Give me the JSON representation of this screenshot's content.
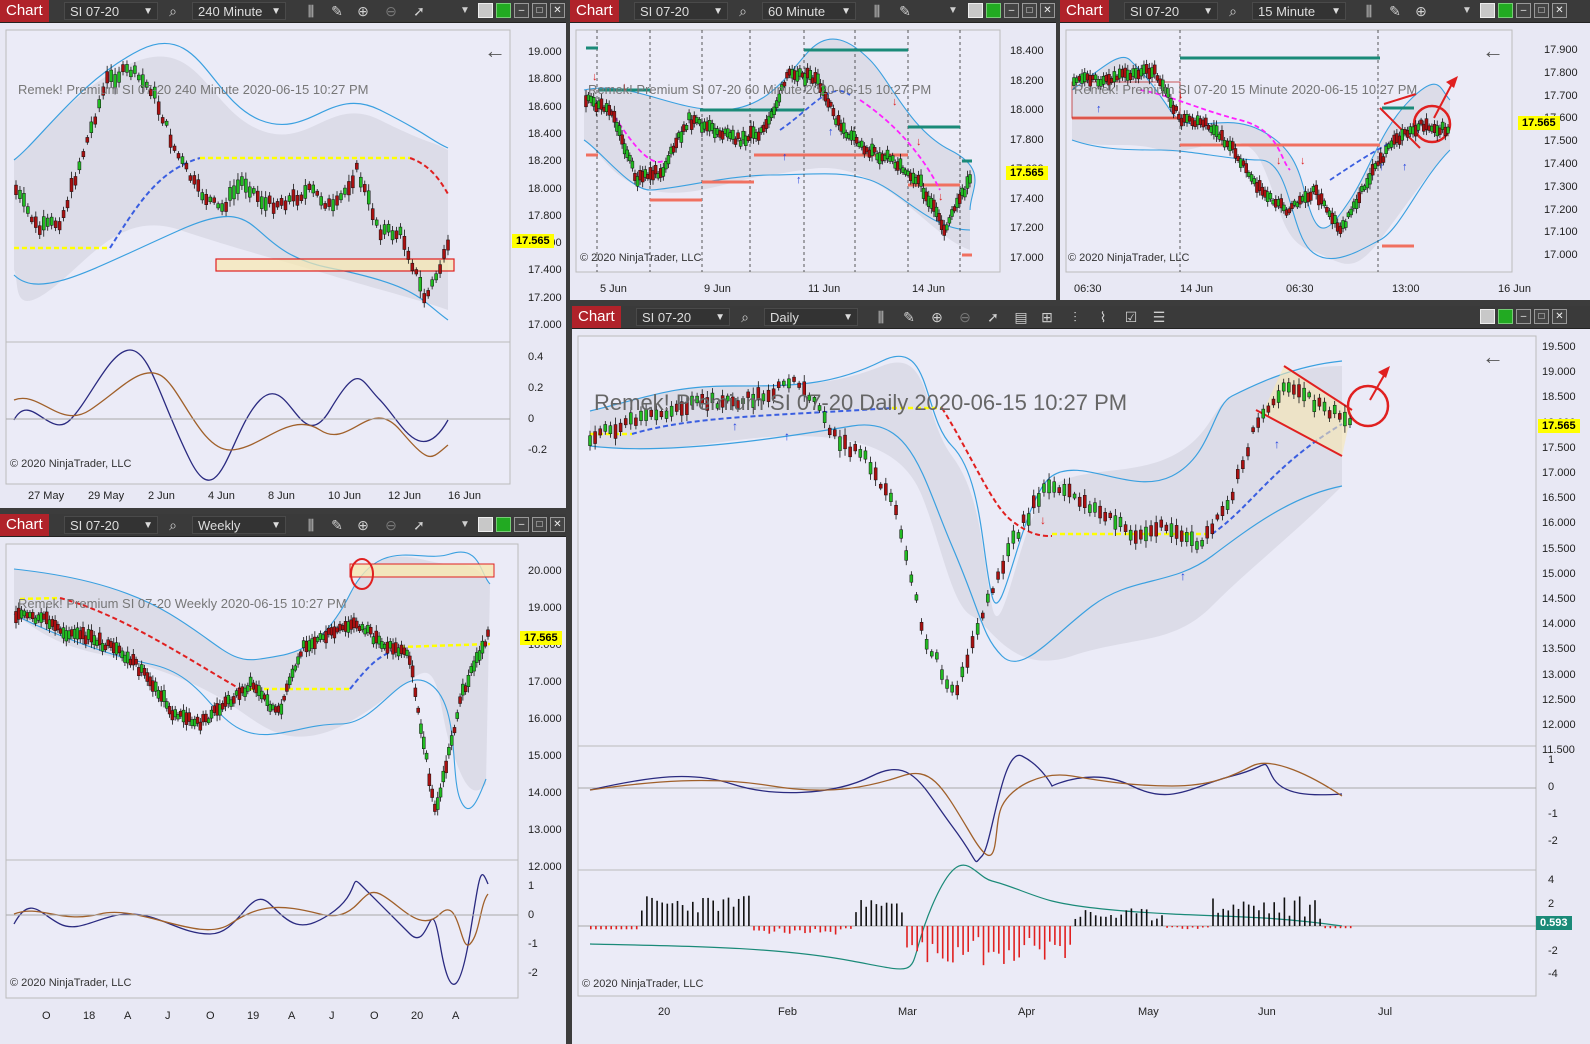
{
  "common": {
    "tab_label": "Chart",
    "instrument": "SI 07-20",
    "copyright": "© 2020 NinjaTrader, LLC",
    "last_price": "17.565"
  },
  "charts": {
    "m240": {
      "interval": "240 Minute",
      "title": "Remek!  Premium  SI 07-20  240 Minute  2020-06-15 10:27 PM",
      "price_ticks": [
        "19.000",
        "18.800",
        "18.600",
        "18.400",
        "18.200",
        "18.000",
        "17.800",
        "17.600",
        "17.400",
        "17.200",
        "17.000"
      ],
      "osc_ticks": [
        "0.4",
        "0.2",
        "0",
        "-0.2"
      ],
      "time_ticks": [
        "27 May",
        "29 May",
        "2 Jun",
        "4 Jun",
        "8 Jun",
        "10 Jun",
        "12 Jun",
        "16 Jun"
      ]
    },
    "m60": {
      "interval": "60 Minute",
      "title": "Remek!  Premium  SI 07-20  60 Minute  2020-06-15 10:27 PM",
      "price_ticks": [
        "18.400",
        "18.200",
        "18.000",
        "17.800",
        "17.600",
        "17.400",
        "17.200",
        "17.000"
      ],
      "time_ticks": [
        "5 Jun",
        "9 Jun",
        "11 Jun",
        "14 Jun"
      ]
    },
    "m15": {
      "interval": "15 Minute",
      "title": "Remek!  Premium  SI 07-20  15 Minute  2020-06-15 10:27 PM",
      "price_ticks": [
        "17.900",
        "17.800",
        "17.700",
        "17.600",
        "17.500",
        "17.400",
        "17.300",
        "17.200",
        "17.100",
        "17.000"
      ],
      "time_ticks": [
        "06:30",
        "14 Jun",
        "06:30",
        "13:00",
        "16 Jun"
      ]
    },
    "weekly": {
      "interval": "Weekly",
      "title": "Remek!  Premium  SI 07-20  Weekly  2020-06-15 10:27 PM",
      "price_ticks": [
        "20.000",
        "19.000",
        "18.000",
        "17.000",
        "16.000",
        "15.000",
        "14.000",
        "13.000",
        "12.000"
      ],
      "osc_ticks": [
        "1",
        "0",
        "-1",
        "-2"
      ],
      "time_ticks": [
        "O",
        "18",
        "A",
        "J",
        "O",
        "19",
        "A",
        "J",
        "O",
        "20",
        "A"
      ]
    },
    "daily": {
      "interval": "Daily",
      "title": "Remek!  Premium  SI 07-20  Daily  2020-06-15 10:27 PM",
      "price_ticks": [
        "19.500",
        "19.000",
        "18.500",
        "18.000",
        "17.500",
        "17.000",
        "16.500",
        "16.000",
        "15.500",
        "15.000",
        "14.500",
        "14.000",
        "13.500",
        "13.000",
        "12.500",
        "12.000",
        "11.500"
      ],
      "osc_ticks": [
        "1",
        "0",
        "-1",
        "-2"
      ],
      "hist_ticks": [
        "4",
        "2",
        "0",
        "-2",
        "-4"
      ],
      "hist_value": "0.593",
      "time_ticks": [
        "20",
        "Feb",
        "Mar",
        "Apr",
        "May",
        "Jun",
        "Jul"
      ]
    }
  }
}
